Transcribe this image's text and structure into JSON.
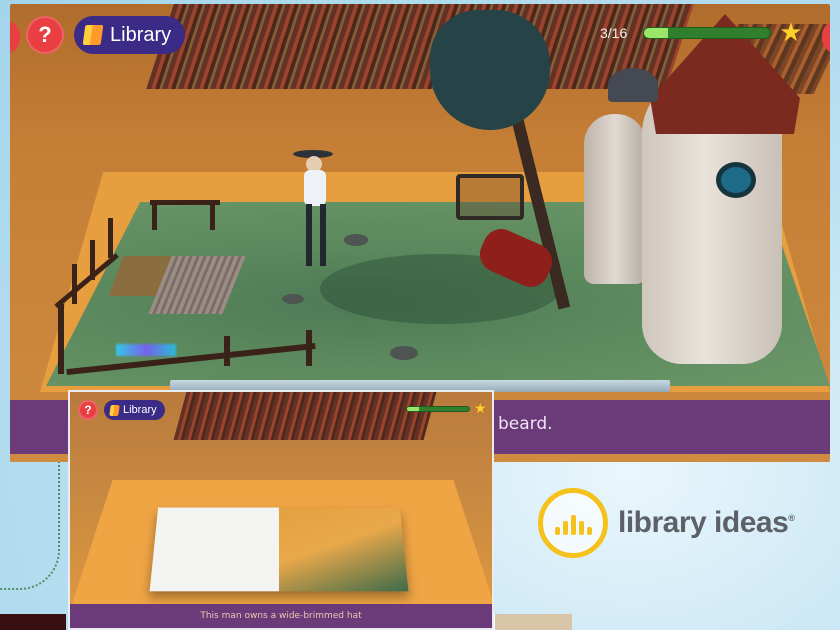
{
  "main_screen": {
    "help_label": "?",
    "library_label": "Library",
    "progress_text": "3/16",
    "progress_fraction": 0.19,
    "caption_text": "beard."
  },
  "inset_screen": {
    "help_label": "?",
    "library_label": "Library",
    "progress_fraction": 0.19,
    "caption_text": "This man owns a wide-brimmed hat"
  },
  "logo": {
    "text": "library ideas",
    "mark": "®"
  },
  "colors": {
    "help_button": "#e93e42",
    "library_pill": "#3b2b86",
    "progress_fill": "#9be56a",
    "caption_bar": "#6b3a78",
    "logo_ring": "#f4c21b"
  },
  "icons": {
    "help": "question-mark-icon",
    "library": "book-icon",
    "progress": "star-icon"
  }
}
